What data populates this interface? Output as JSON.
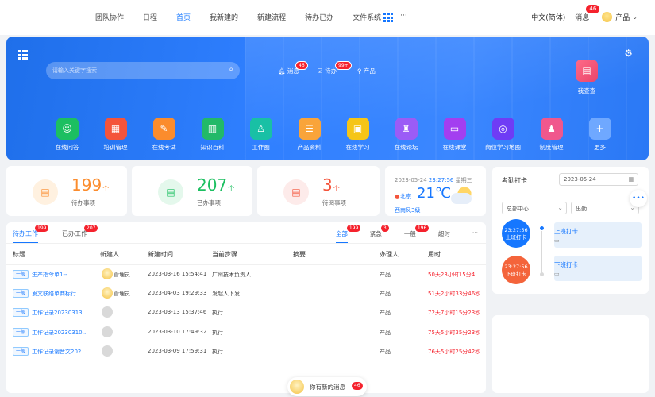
{
  "topnav": {
    "menu": [
      "团队协作",
      "日程",
      "首页",
      "我新建的",
      "新建流程",
      "待办已办",
      "文件系统",
      "···"
    ],
    "active_index": 2,
    "lang": "中文(简体)",
    "msg": "消息",
    "msg_badge": "46",
    "user": "产品"
  },
  "hero": {
    "search_placeholder": "请输入关键字搜索",
    "quick": [
      {
        "label": "消息",
        "badge": "46",
        "icon": "bell-icon"
      },
      {
        "label": "待办",
        "badge": "99+",
        "icon": "todo-icon"
      },
      {
        "label": "产品",
        "badge": "",
        "icon": "user-icon"
      }
    ],
    "mine_label": "我查查",
    "apps": [
      {
        "label": "在线问答",
        "color": "#1cbf61"
      },
      {
        "label": "培训管理",
        "color": "#f4543b"
      },
      {
        "label": "在线考试",
        "color": "#fb8c2d"
      },
      {
        "label": "知识百科",
        "color": "#22b968"
      },
      {
        "label": "工作圈",
        "color": "#19c0a5"
      },
      {
        "label": "产品资料",
        "color": "#f9a43a"
      },
      {
        "label": "在线学习",
        "color": "#f5c518"
      },
      {
        "label": "在线论坛",
        "color": "#9b5cf6"
      },
      {
        "label": "在线课堂",
        "color": "#a33ef0"
      },
      {
        "label": "岗位学习地图",
        "color": "#6f3cf5"
      },
      {
        "label": "制度管理",
        "color": "#f0578d"
      },
      {
        "label": "更多",
        "color": "#6fa8ff"
      }
    ]
  },
  "stats": [
    {
      "num": "199",
      "unit": "个",
      "label": "待办事项",
      "color": "#fb8c2d",
      "bg": "#fff1e0"
    },
    {
      "num": "207",
      "unit": "个",
      "label": "已办事项",
      "color": "#1cbf61",
      "bg": "#e4f8ec"
    },
    {
      "num": "3",
      "unit": "个",
      "label": "待阅事项",
      "color": "#f4543b",
      "bg": "#fdebea"
    }
  ],
  "weather": {
    "date": "2023-05-24",
    "time": "23:27:56",
    "weekday": "星期三",
    "city": "北京",
    "temp": "21℃",
    "wind": "西南风3级"
  },
  "tasks": {
    "tabs": [
      {
        "label": "待办工作",
        "badge": "199",
        "active": true
      },
      {
        "label": "已办工作",
        "badge": "207",
        "active": false
      }
    ],
    "filters": [
      {
        "label": "全部",
        "badge": "199",
        "active": true
      },
      {
        "label": "紧急",
        "badge": "3",
        "active": false
      },
      {
        "label": "一般",
        "badge": "196",
        "active": false
      },
      {
        "label": "超时",
        "badge": "",
        "active": false
      },
      {
        "label": "···",
        "badge": "",
        "active": false
      }
    ],
    "headers": [
      "标题",
      "新建人",
      "新建时间",
      "当前步骤",
      "摘要",
      "办理人",
      "用时"
    ],
    "rows": [
      {
        "tag": "一般",
        "title": "生产指令单1--",
        "creator": "管理员",
        "created": "2023-03-16 15:54:41",
        "step": "广州技术负责人",
        "handler": "产品",
        "duration": "50天23小时15分4…",
        "avatar": true
      },
      {
        "tag": "一般",
        "title": "发文联络单商标行…",
        "creator": "管理员",
        "created": "2023-04-03 19:29:33",
        "step": "发起人下发",
        "handler": "产品",
        "duration": "51天2小时33分46秒",
        "avatar": true
      },
      {
        "tag": "一般",
        "title": "工作记录20230313…",
        "creator": "",
        "created": "2023-03-13 15:37:46",
        "step": "执行",
        "handler": "产品",
        "duration": "72天7小时15分23秒",
        "avatar": false
      },
      {
        "tag": "一般",
        "title": "工作记录20230310…",
        "creator": "",
        "created": "2023-03-10 17:49:32",
        "step": "执行",
        "handler": "产品",
        "duration": "75天5小时35分23秒",
        "avatar": false
      },
      {
        "tag": "一般",
        "title": "工作记录谢晋文202…",
        "creator": "",
        "created": "2023-03-09 17:59:31",
        "step": "执行",
        "handler": "产品",
        "duration": "76天5小时25分42秒",
        "avatar": false
      }
    ]
  },
  "clock": {
    "title": "考勤打卡",
    "date": "2023-05-24",
    "dept": "总部中心",
    "type": "出勤",
    "punches": [
      {
        "time": "23:27:56",
        "label": "上班打卡",
        "title": "上班打卡",
        "color": "#1677ff"
      },
      {
        "time": "23:27:56",
        "label": "下班打卡",
        "title": "下班打卡",
        "color": "#f4643b"
      }
    ]
  },
  "toast": {
    "text": "你有新的消息",
    "badge": "46"
  }
}
